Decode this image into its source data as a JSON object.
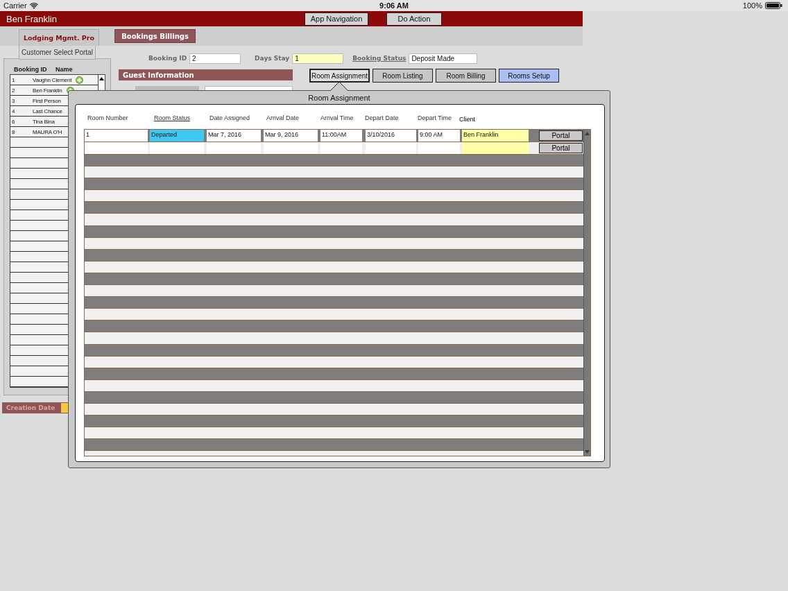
{
  "status_bar": {
    "carrier": "Carrier",
    "time": "9:06 AM",
    "battery": "100%"
  },
  "header": {
    "title": "Ben Franklin",
    "buttons": [
      "App Navigation",
      "Do Action"
    ]
  },
  "top_tabs": [
    {
      "label": "Lodging Mgmt. Pro",
      "kind": "tab"
    },
    {
      "label": "Bookings Billings",
      "kind": "button"
    }
  ],
  "customer_portal": {
    "tab": "Customer Select Portal",
    "columns": [
      "Booking ID",
      "Name"
    ],
    "rows": [
      {
        "id": "1",
        "name": "Vaughn Clement",
        "add_icon": true
      },
      {
        "id": "2",
        "name": "Ben Franklin",
        "add_icon": true
      },
      {
        "id": "3",
        "name": "First Person",
        "add_icon": false
      },
      {
        "id": "4",
        "name": "Last Chance",
        "add_icon": false
      },
      {
        "id": "6",
        "name": "Tina Bina",
        "add_icon": false
      },
      {
        "id": "8",
        "name": "MAURA O'H",
        "add_icon": false
      }
    ]
  },
  "booking": {
    "fields": [
      {
        "label": "Booking ID",
        "value": "2",
        "highlighted": false,
        "underlined": false
      },
      {
        "label": "Days Stay",
        "value": "1",
        "highlighted": true,
        "underlined": false
      },
      {
        "label": "Booking Status",
        "value": "Deposit Made",
        "highlighted": false,
        "underlined": true
      }
    ]
  },
  "guest_information": {
    "title": "Guest Information"
  },
  "room_tabs": [
    {
      "label": "Room Assignment",
      "selected": true,
      "highlighted": false
    },
    {
      "label": "Room Listing",
      "selected": false,
      "highlighted": false
    },
    {
      "label": "Room Billing",
      "selected": false,
      "highlighted": false
    },
    {
      "label": "Rooms Setup",
      "selected": false,
      "highlighted": true
    }
  ],
  "creation_date": {
    "label": "Creation Date"
  },
  "popover": {
    "title": "Room Assignment",
    "columns": [
      {
        "label": "Room Number",
        "underlined": false
      },
      {
        "label": "Room Status",
        "underlined": true
      },
      {
        "label": "Date Assigned",
        "underlined": false
      },
      {
        "label": "Arrival Date",
        "underlined": false
      },
      {
        "label": "Arrival Time",
        "underlined": false
      },
      {
        "label": "Depart Date",
        "underlined": false
      },
      {
        "label": "Depart Time",
        "underlined": false
      },
      {
        "label": "Client",
        "underlined": false
      }
    ],
    "rows": [
      {
        "room_number": "1",
        "room_status": "Departed",
        "color": "#40c8f4",
        "date_assigned": "Mar 7, 2016",
        "arrival_date": "Mar 9, 2016",
        "arrival_time": "11:00AM",
        "depart_date": "3/10/2016",
        "depart_time": "9:00 AM",
        "client": "Ben Franklin",
        "button": "Portal"
      },
      {
        "button": "Portal"
      }
    ]
  }
}
